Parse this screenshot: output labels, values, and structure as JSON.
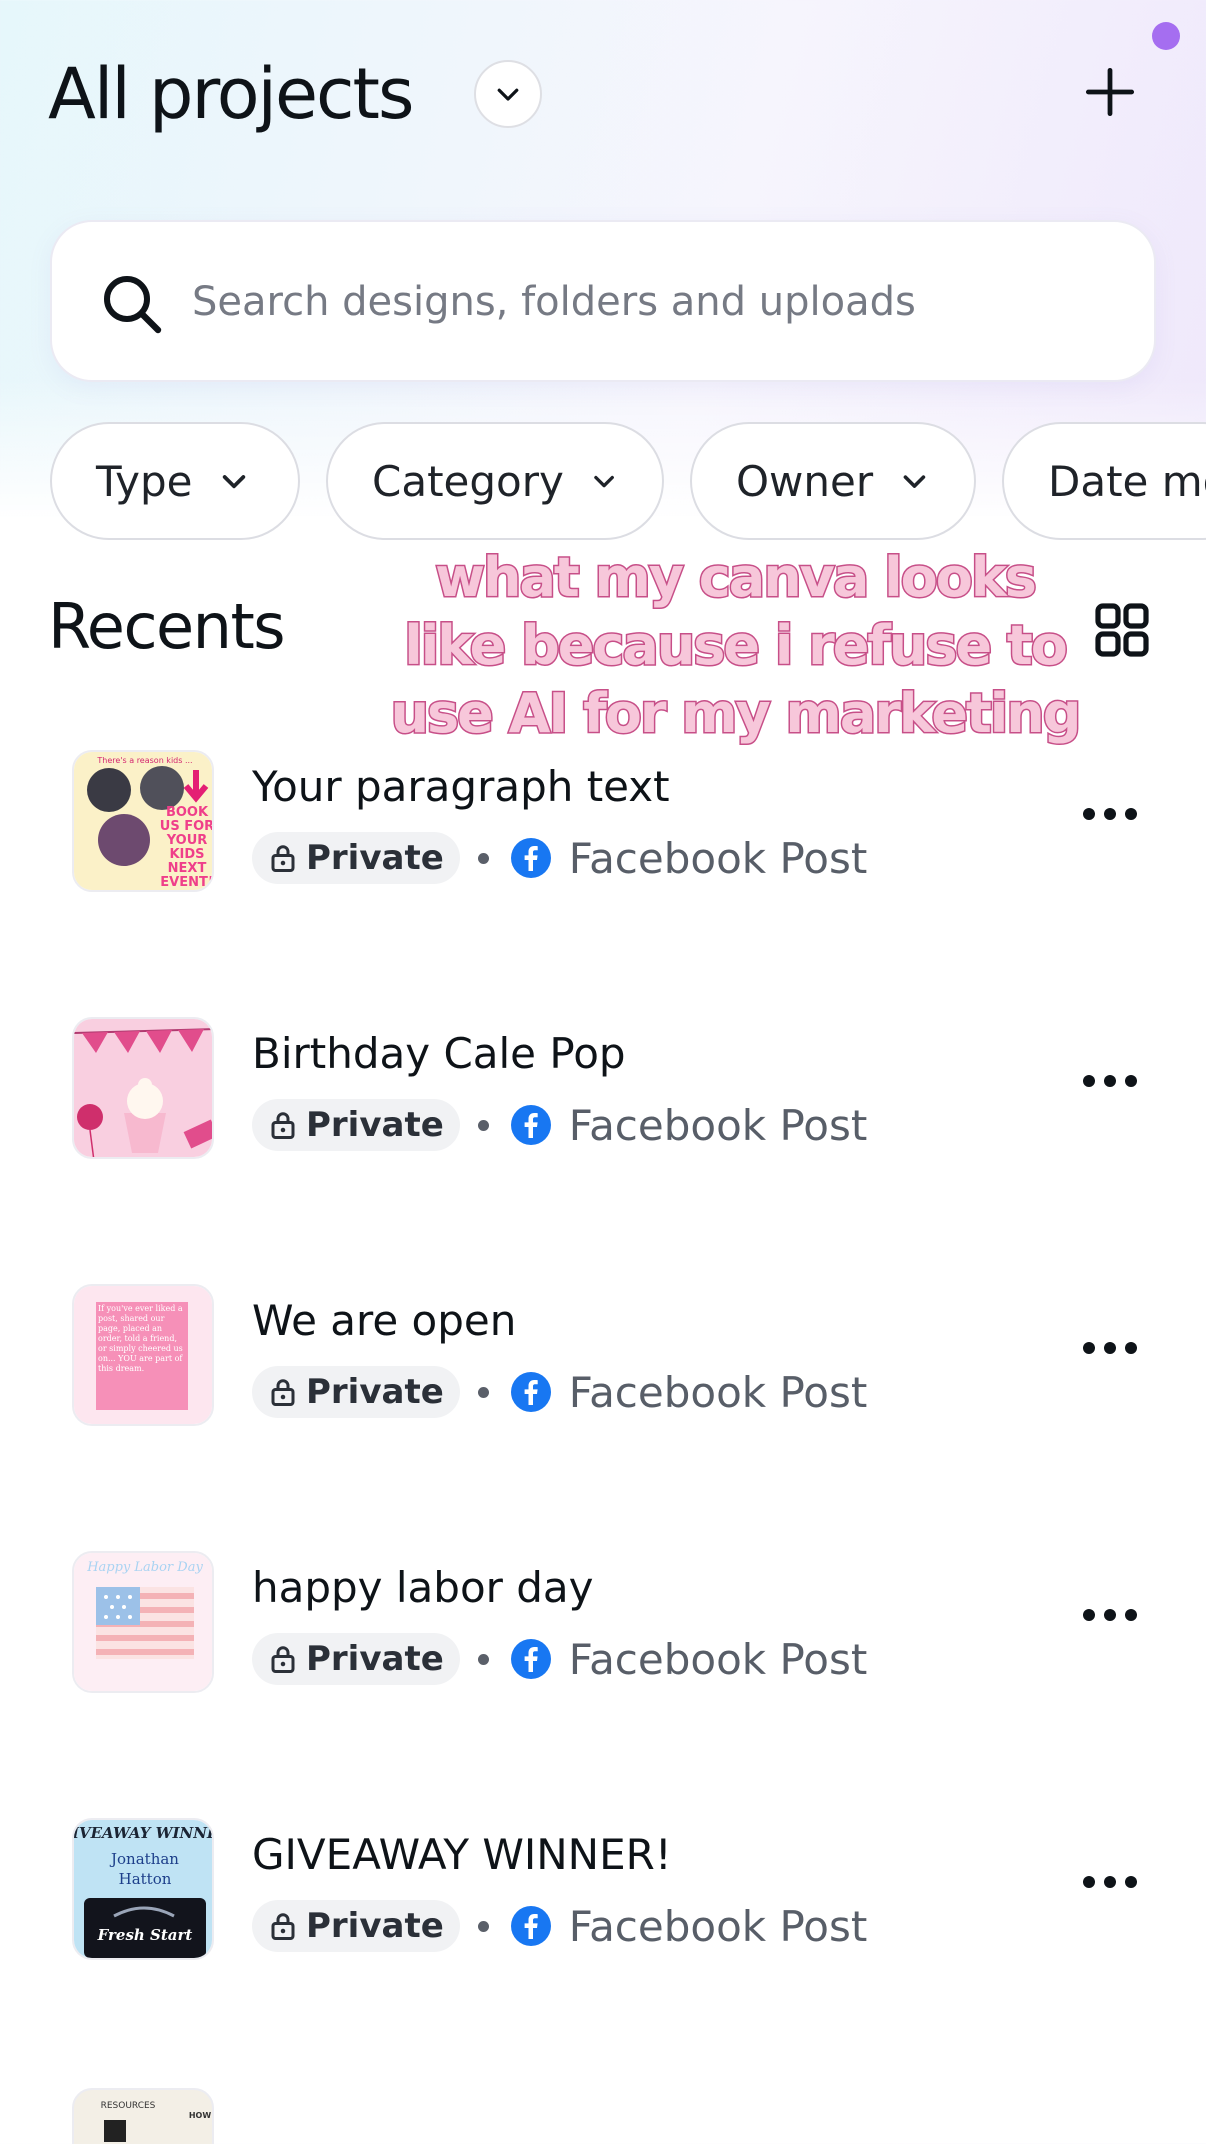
{
  "header": {
    "title": "All projects"
  },
  "search": {
    "placeholder": "Search designs, folders and uploads"
  },
  "filters": [
    "Type",
    "Category",
    "Owner",
    "Date mo"
  ],
  "section": {
    "title": "Recents"
  },
  "overlay_text": "what my canva looks like because i refuse to use AI for my marketing",
  "items": [
    {
      "title": "Your paragraph text",
      "privacy": "Private",
      "type": "Facebook Post"
    },
    {
      "title": "Birthday Cale Pop",
      "privacy": "Private",
      "type": "Facebook Post"
    },
    {
      "title": "We are open",
      "privacy": "Private",
      "type": "Facebook Post"
    },
    {
      "title": "happy labor day",
      "privacy": "Private",
      "type": "Facebook Post"
    },
    {
      "title": "GIVEAWAY WINNER!",
      "privacy": "Private",
      "type": "Facebook Post"
    }
  ],
  "thumbs": {
    "paragraph": {
      "top": "There's a reason kids ...",
      "big": "BOOK US FOR YOUR KIDS NEXT EVENT!"
    },
    "open": {
      "text": "If you've ever liked a post, shared our page, placed an order, told a friend, or simply cheered us on... YOU are part of this dream."
    },
    "labor": {
      "text": "Happy Labor Day"
    },
    "giveaway": {
      "banner": "GIVEAWAY WINNER",
      "name1": "Jonathan",
      "name2": "Hatton",
      "logo": "Fresh Start"
    }
  },
  "partial_item": {
    "thumb_text": "RESOURCES",
    "thumb_small": "HOW"
  },
  "colors": {
    "accent_dot": "#a56ef0",
    "facebook": "#1877f2",
    "overlay_fill": "#f7c7da",
    "overlay_stroke": "#c74f88"
  }
}
